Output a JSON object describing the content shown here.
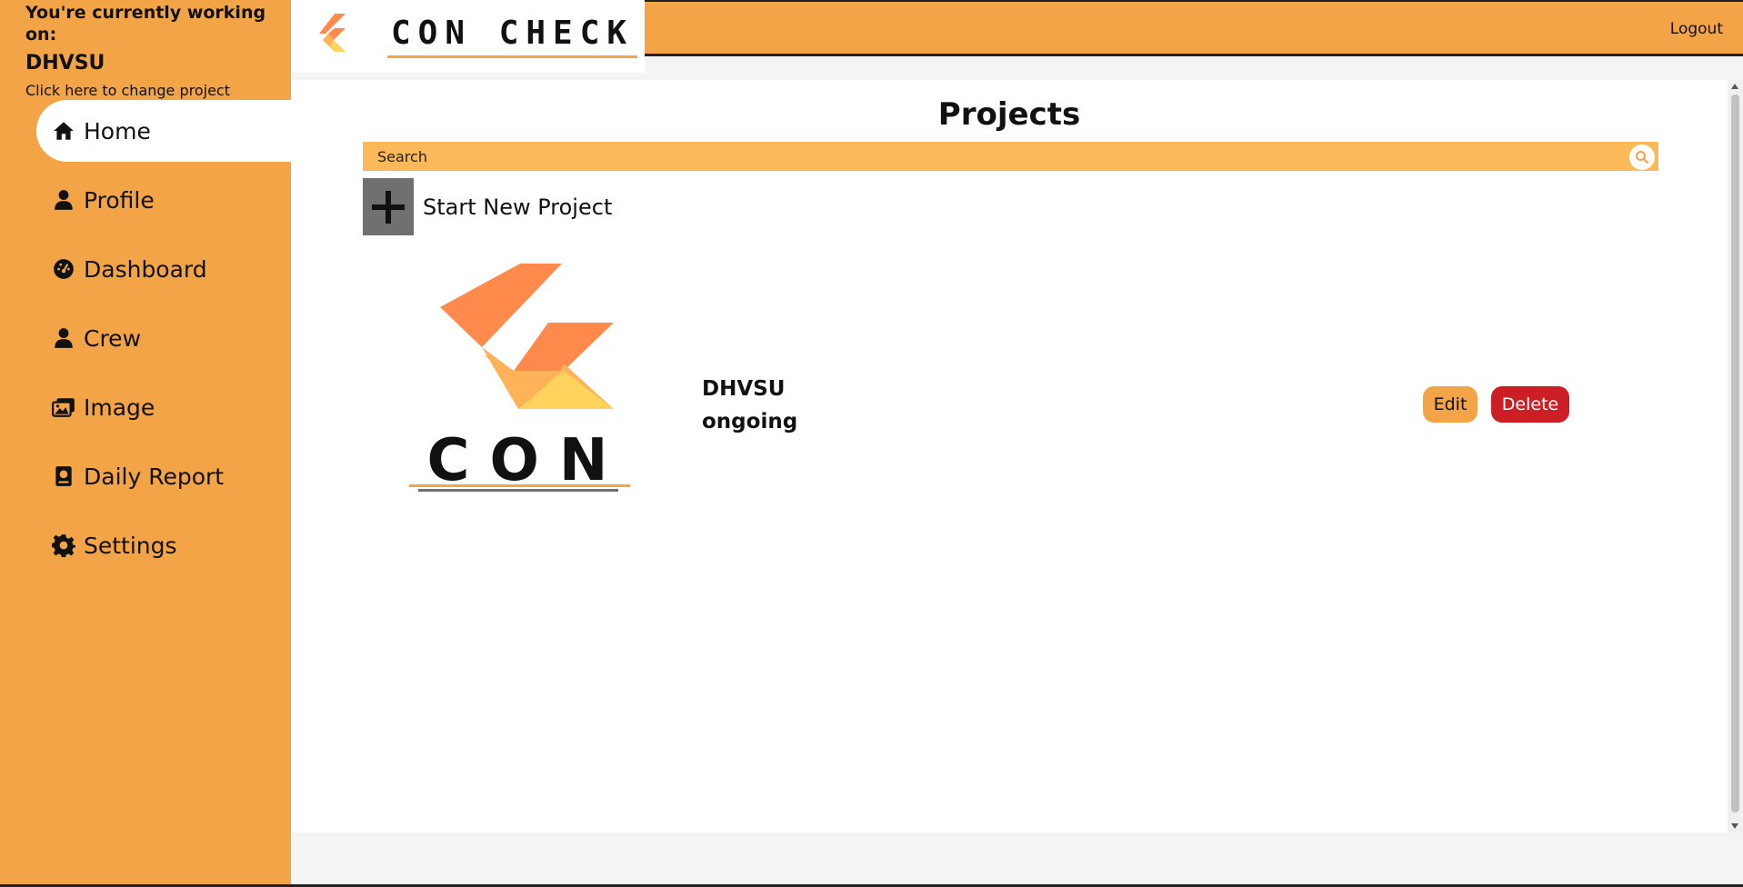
{
  "sidebar": {
    "caption": "You're currently working on:",
    "current_project": "DHVSU",
    "change_link": "Click here to change project",
    "items": [
      {
        "label": "Home",
        "icon": "home-icon"
      },
      {
        "label": "Profile",
        "icon": "user-icon"
      },
      {
        "label": "Dashboard",
        "icon": "dashboard-icon"
      },
      {
        "label": "Crew",
        "icon": "user-icon"
      },
      {
        "label": "Image",
        "icon": "images-icon"
      },
      {
        "label": "Daily Report",
        "icon": "book-icon"
      },
      {
        "label": "Settings",
        "icon": "gear-icon"
      }
    ],
    "active_index": 0
  },
  "header": {
    "logo_text": "CON CHECK",
    "logout": "Logout"
  },
  "main": {
    "title": "Projects",
    "search": {
      "placeholder": "Search"
    },
    "new_project_label": "Start New Project",
    "projects": [
      {
        "name": "DHVSU",
        "status": "ongoing",
        "edit_label": "Edit",
        "delete_label": "Delete"
      }
    ]
  },
  "colors": {
    "accent": "#f2a446",
    "search_bg": "#fcb95a",
    "danger": "#cc1f25",
    "logo_orange": "#ff8a4c",
    "logo_yellow": "#ffd35c"
  }
}
